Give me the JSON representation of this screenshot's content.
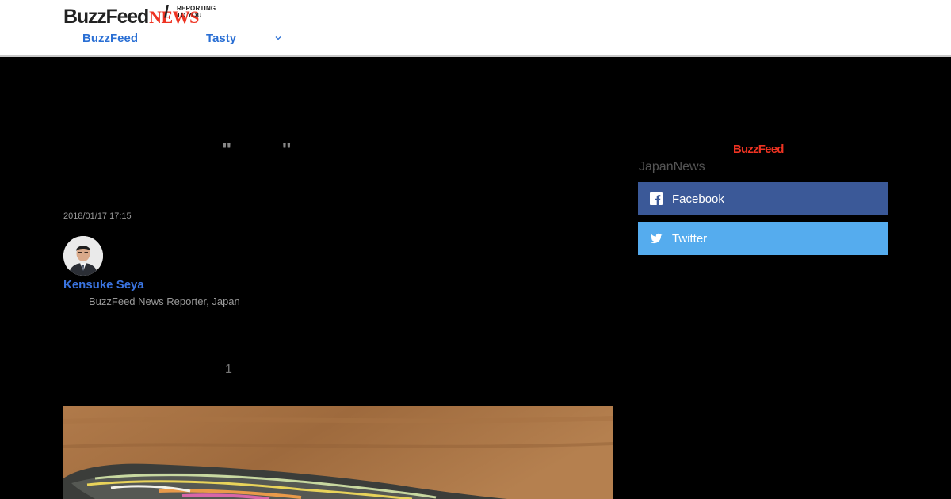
{
  "header": {
    "logo_buzzfeed": "BuzzFeed",
    "logo_news": "NEWS",
    "logo_slash": "/",
    "tagline_line1": "REPORTING",
    "tagline_line2": "TO YOU",
    "nav": [
      {
        "label": "BuzzFeed"
      },
      {
        "label": "Tasty"
      }
    ]
  },
  "article": {
    "headline_marks": "\" \"",
    "timestamp": "2018/01/17 17:15",
    "author": {
      "name": "Kensuke Seya",
      "role": "BuzzFeed News Reporter, Japan"
    },
    "footnote_number": "1"
  },
  "sidebar": {
    "brand": "BuzzFeed",
    "label": "JapanNews",
    "share": [
      {
        "label": "Facebook"
      },
      {
        "label": "Twitter"
      }
    ]
  },
  "colors": {
    "facebook": "#3b5998",
    "twitter": "#55acee",
    "link": "#2a6fd4",
    "brand_red": "#e33322"
  }
}
